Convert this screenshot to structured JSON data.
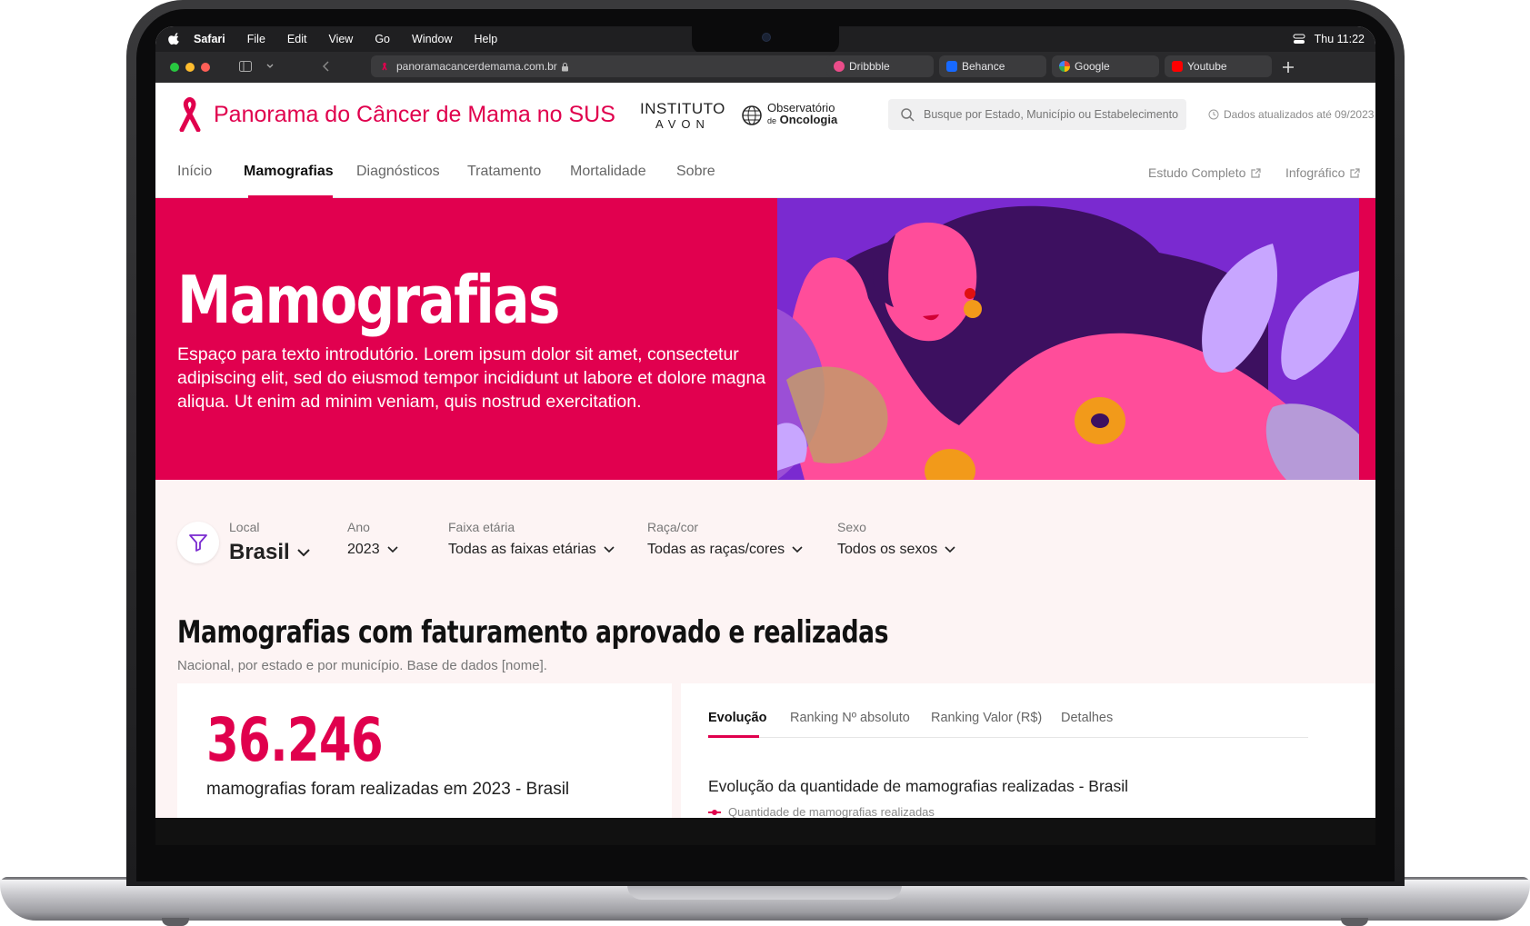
{
  "menubar": {
    "app": "Safari",
    "items": [
      "File",
      "Edit",
      "View",
      "Go",
      "Window",
      "Help"
    ],
    "clock": "Thu 11:22"
  },
  "browser": {
    "url": "panoramacancerdemama.com.br",
    "tabs": [
      {
        "label": "Dribbble",
        "icon": "dribbble-icon",
        "color": "#ea4c89"
      },
      {
        "label": "Behance",
        "icon": "behance-icon",
        "color": "#1769ff"
      },
      {
        "label": "Google",
        "icon": "google-icon",
        "color": "#4285f4"
      },
      {
        "label": "Youtube",
        "icon": "youtube-icon",
        "color": "#ff0000"
      }
    ]
  },
  "site": {
    "brand": "Panorama do Câncer de Mama no SUS",
    "partner1": {
      "line1": "INSTITUTO",
      "line2": "AVON"
    },
    "partner2": {
      "line1": "Observatório",
      "line2": "de",
      "line3": "Oncologia"
    },
    "search_placeholder": "Busque por Estado, Município ou Estabelecimento",
    "updated": "Dados atualizados até 09/2023",
    "nav": {
      "items": [
        "Início",
        "Mamografias",
        "Diagnósticos",
        "Tratamento",
        "Mortalidade",
        "Sobre"
      ],
      "active": "Mamografias",
      "external": [
        "Estudo Completo",
        "Infográfico"
      ]
    },
    "accent_color": "#e0004d"
  },
  "hero": {
    "title": "Mamografias",
    "text": "Espaço para texto introdutório. Lorem ipsum dolor sit amet, consectetur adipiscing elit, sed do eiusmod tempor incididunt ut labore et dolore magna aliqua. Ut enim ad minim veniam, quis nostrud exercitation."
  },
  "filters": {
    "local": {
      "label": "Local",
      "value": "Brasil"
    },
    "ano": {
      "label": "Ano",
      "value": "2023"
    },
    "faixa": {
      "label": "Faixa etária",
      "value": "Todas as faixas etárias"
    },
    "raca": {
      "label": "Raça/cor",
      "value": "Todas as raças/cores"
    },
    "sexo": {
      "label": "Sexo",
      "value": "Todos os sexos"
    }
  },
  "section": {
    "title": "Mamografias com faturamento aprovado e realizadas",
    "subtitle": "Nacional, por estado e por município. Base de dados [nome].",
    "kpi_value": "36.246",
    "kpi_caption": "mamografias foram realizadas em 2023 - Brasil",
    "tabs": [
      "Evolução",
      "Ranking Nº absoluto",
      "Ranking Valor (R$)",
      "Detalhes"
    ],
    "active_tab": "Evolução",
    "chart_title": "Evolução da quantidade de mamografias realizadas - Brasil",
    "legend": "Quantidade de mamografias realizadas"
  }
}
